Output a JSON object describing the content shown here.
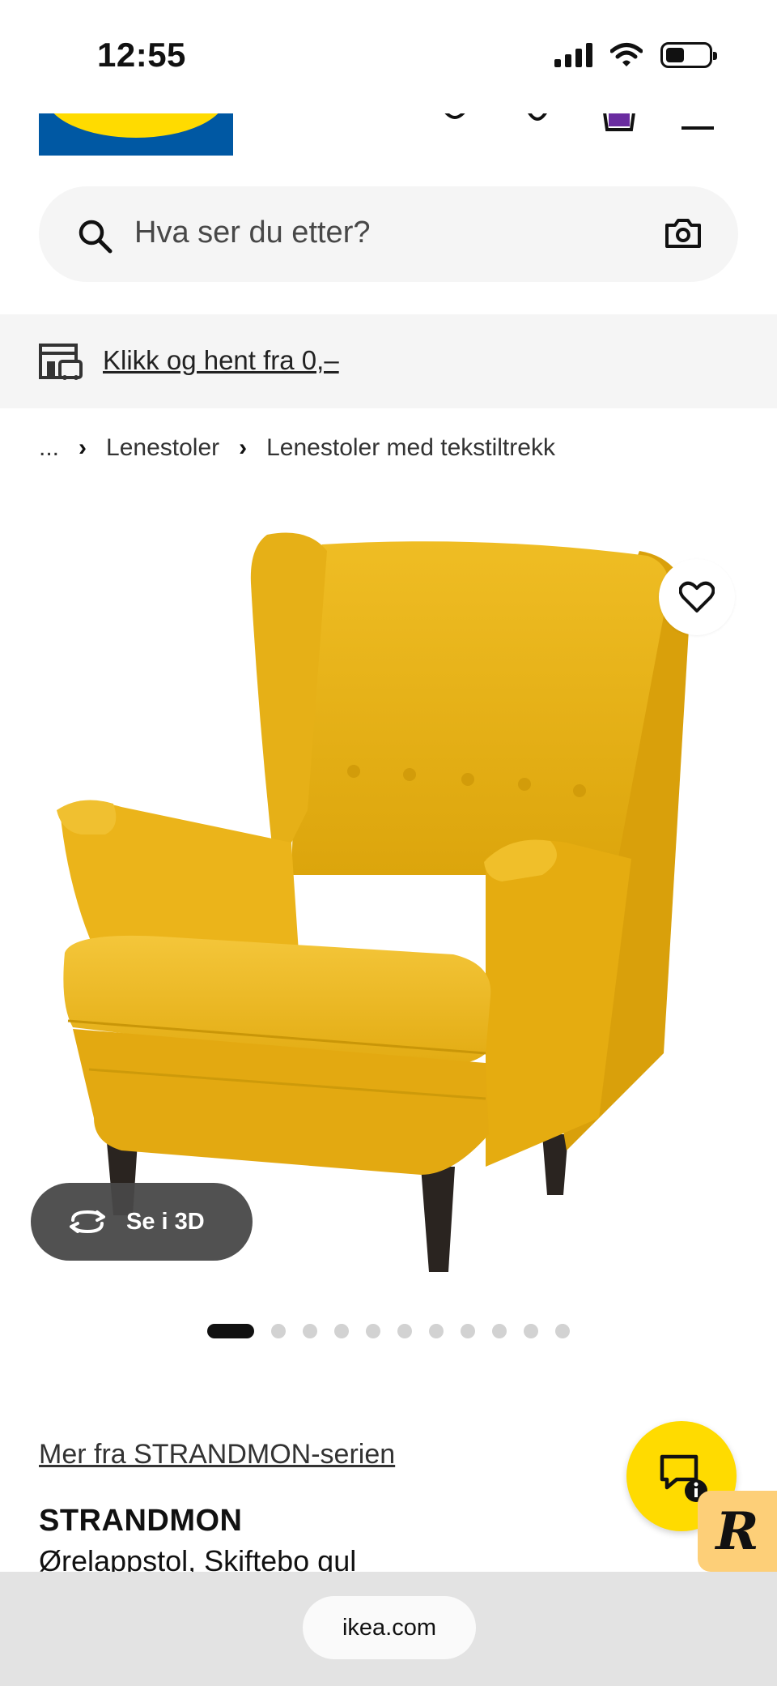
{
  "status_bar": {
    "time": "12:55"
  },
  "header": {
    "logo_alt": "IKEA",
    "icons": [
      "account-icon",
      "location-icon",
      "cart-icon",
      "menu-icon"
    ]
  },
  "search": {
    "placeholder": "Hva ser du etter?",
    "icon": "search-icon",
    "camera_icon": "camera-icon"
  },
  "promo": {
    "text": "Klikk og hent fra 0,–",
    "icon": "store-pickup-icon"
  },
  "breadcrumb": {
    "ellipsis": "...",
    "items": [
      "Lenestoler",
      "Lenestoler med tekstiltrekk"
    ]
  },
  "gallery": {
    "view_3d_label": "Se i 3D",
    "dot_count": 11,
    "active_index": 0
  },
  "product": {
    "series_link": "Mer fra STRANDMON-serien",
    "name": "STRANDMON",
    "description": "Ørelappstol, Skiftebo gul"
  },
  "colors": {
    "ikea_blue": "#0058a3",
    "ikea_yellow": "#ffdb00",
    "chair_yellow": "#e9b10f"
  },
  "browser": {
    "url": "ikea.com"
  }
}
